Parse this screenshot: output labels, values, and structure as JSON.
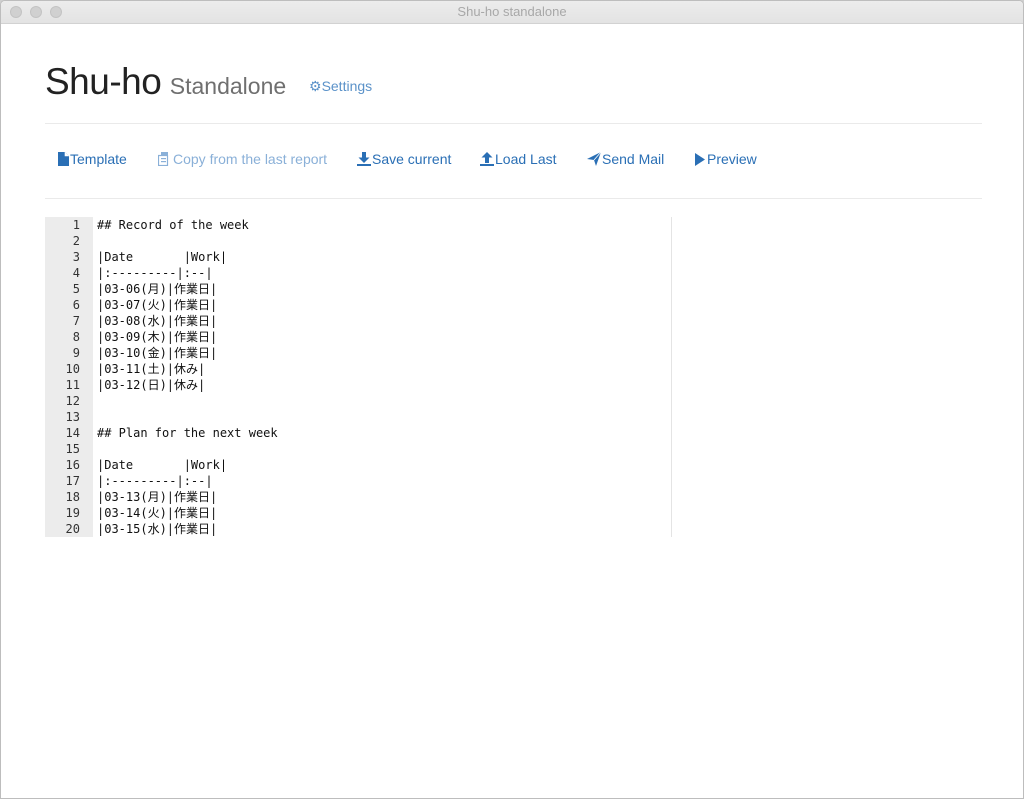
{
  "window": {
    "title": "Shu-ho standalone"
  },
  "header": {
    "title": "Shu-ho",
    "subtitle": "Standalone",
    "settings_label": "Settings"
  },
  "toolbar": {
    "template_label": "Template",
    "copy_label": "Copy from the last report",
    "save_label": "Save current",
    "load_label": "Load Last",
    "send_label": "Send Mail",
    "preview_label": "Preview"
  },
  "editor": {
    "lines": [
      {
        "n": "1",
        "text": "## Record of the week"
      },
      {
        "n": "2",
        "text": ""
      },
      {
        "n": "3",
        "text": "|Date       |Work|"
      },
      {
        "n": "4",
        "text": "|:---------|:--|"
      },
      {
        "n": "5",
        "text": "|03-06(月)|作業日|"
      },
      {
        "n": "6",
        "text": "|03-07(火)|作業日|"
      },
      {
        "n": "7",
        "text": "|03-08(水)|作業日|"
      },
      {
        "n": "8",
        "text": "|03-09(木)|作業日|"
      },
      {
        "n": "9",
        "text": "|03-10(金)|作業日|"
      },
      {
        "n": "10",
        "text": "|03-11(土)|休み|"
      },
      {
        "n": "11",
        "text": "|03-12(日)|休み|"
      },
      {
        "n": "12",
        "text": ""
      },
      {
        "n": "13",
        "text": ""
      },
      {
        "n": "14",
        "text": "## Plan for the next week"
      },
      {
        "n": "15",
        "text": ""
      },
      {
        "n": "16",
        "text": "|Date       |Work|"
      },
      {
        "n": "17",
        "text": "|:---------|:--|"
      },
      {
        "n": "18",
        "text": "|03-13(月)|作業日|"
      },
      {
        "n": "19",
        "text": "|03-14(火)|作業日|"
      },
      {
        "n": "20",
        "text": "|03-15(水)|作業日|"
      }
    ]
  },
  "colors": {
    "link": "#2a6fb5",
    "link_disabled": "#8ab0d8",
    "settings": "#5b92c9",
    "gutter": "#ececec"
  },
  "icons": {
    "settings": "gear-icon",
    "template": "file-icon",
    "copy": "copy-icon",
    "save": "download-icon",
    "load": "upload-icon",
    "send": "send-icon",
    "preview": "play-icon"
  }
}
